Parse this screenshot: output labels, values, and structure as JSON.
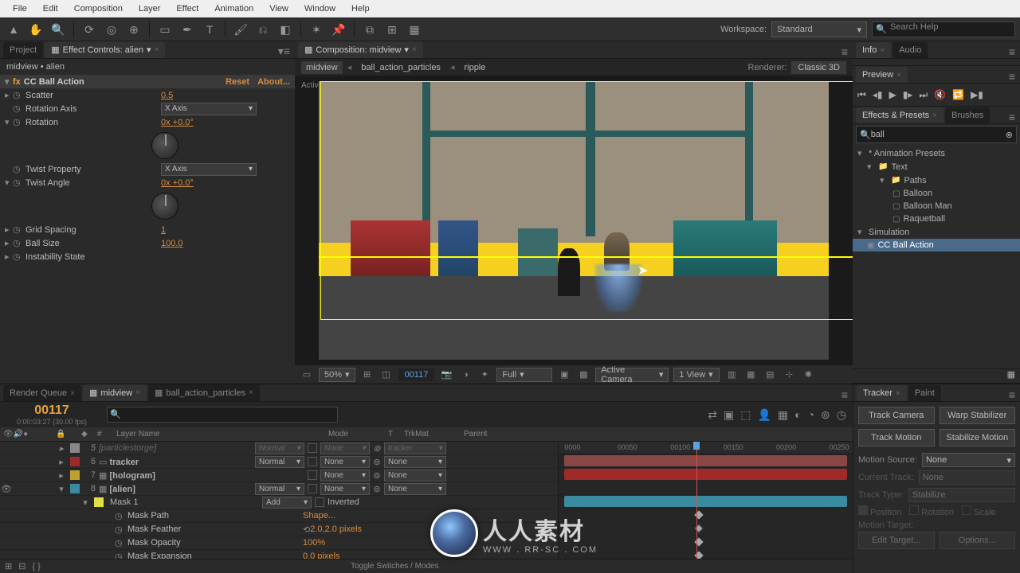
{
  "menu": [
    "File",
    "Edit",
    "Composition",
    "Layer",
    "Effect",
    "Animation",
    "View",
    "Window",
    "Help"
  ],
  "workspace": {
    "label": "Workspace:",
    "value": "Standard"
  },
  "search_help": "Search Help",
  "left_tabs": {
    "project": "Project",
    "effect_controls": "Effect Controls: alien"
  },
  "effect_path": "midview • alien",
  "effect": {
    "name": "CC Ball Action",
    "reset": "Reset",
    "about": "About...",
    "scatter": {
      "label": "Scatter",
      "value": "0.5"
    },
    "rotation_axis": {
      "label": "Rotation Axis",
      "value": "X Axis"
    },
    "rotation": {
      "label": "Rotation",
      "value": "0x +0.0°"
    },
    "twist_property": {
      "label": "Twist Property",
      "value": "X Axis"
    },
    "twist_angle": {
      "label": "Twist Angle",
      "value": "0x +0.0°"
    },
    "grid_spacing": {
      "label": "Grid Spacing",
      "value": "1"
    },
    "ball_size": {
      "label": "Ball Size",
      "value": "100.0"
    },
    "instability_state": {
      "label": "Instability State",
      "value": ""
    }
  },
  "comp_tab": "Composition: midview",
  "comp_crumbs": [
    "midview",
    "ball_action_particles",
    "ripple"
  ],
  "renderer": {
    "label": "Renderer:",
    "value": "Classic 3D"
  },
  "active_camera": "Active Camera",
  "viewer_footer": {
    "mag": "50%",
    "frame": "00117",
    "res": "Full",
    "view": "Active Camera",
    "view_count": "1 View"
  },
  "right_tabs": {
    "info": "Info",
    "audio": "Audio",
    "preview": "Preview",
    "effects_presets": "Effects & Presets",
    "brushes": "Brushes"
  },
  "ep_search": "ball",
  "ep_tree": {
    "animation_presets": "* Animation Presets",
    "text": "Text",
    "paths": "Paths",
    "balloon": "Balloon",
    "balloon_man": "Balloon Man",
    "raquetball": "Raquetball",
    "simulation": "Simulation",
    "cc_ball_action": "CC Ball Action"
  },
  "tl_tabs": {
    "render_queue": "Render Queue",
    "midview": "midview",
    "ball_action": "ball_action_particles"
  },
  "current_frame": "00117",
  "current_tc": "0:00:03:27 (30.00 fps)",
  "cols": {
    "num": "#",
    "layer_name": "Layer Name",
    "mode": "Mode",
    "t": "T",
    "trkmat": "TrkMat",
    "parent": "Parent"
  },
  "ruler": [
    "0000",
    "00050",
    "00100",
    "00150",
    "00200",
    "00250"
  ],
  "layers": {
    "cut": {
      "name": "[particlestorge]",
      "mode": "Normal",
      "trk": "None",
      "parent": "tracker"
    },
    "l6": {
      "num": "6",
      "name": "tracker",
      "mode": "Normal",
      "trk": "None",
      "parent": "None"
    },
    "l7": {
      "num": "7",
      "name": "[hologram]",
      "mode": "",
      "trk": "None",
      "parent": "None"
    },
    "l8": {
      "num": "8",
      "name": "[alien]",
      "mode": "Normal",
      "trk": "None",
      "parent": "None"
    },
    "mask1": "Mask 1",
    "mask_mode": "Add",
    "mask_inverted": "Inverted",
    "mask_path": {
      "label": "Mask Path",
      "value": "Shape..."
    },
    "mask_feather": {
      "label": "Mask Feather",
      "value": "2.0,2.0 pixels"
    },
    "mask_opacity": {
      "label": "Mask Opacity",
      "value": "100%"
    },
    "mask_expansion": {
      "label": "Mask Expansion",
      "value": "0.0 pixels"
    }
  },
  "toggle_switches": "Toggle Switches / Modes",
  "tracker": {
    "tab": "Tracker",
    "paint_tab": "Paint",
    "track_camera": "Track Camera",
    "warp_stabilizer": "Warp Stabilizer",
    "track_motion": "Track Motion",
    "stabilize_motion": "Stabilize Motion",
    "motion_source_lbl": "Motion Source:",
    "motion_source": "None",
    "current_track_lbl": "Current Track:",
    "current_track": "None",
    "track_type_lbl": "Track Type:",
    "track_type": "Stabilize",
    "position": "Position",
    "rotation": "Rotation",
    "scale": "Scale",
    "motion_target_lbl": "Motion Target:",
    "edit_target": "Edit Target...",
    "options": "Options..."
  },
  "watermark": {
    "main": "人人素材",
    "sub": "WWW . RR-SC . COM"
  }
}
